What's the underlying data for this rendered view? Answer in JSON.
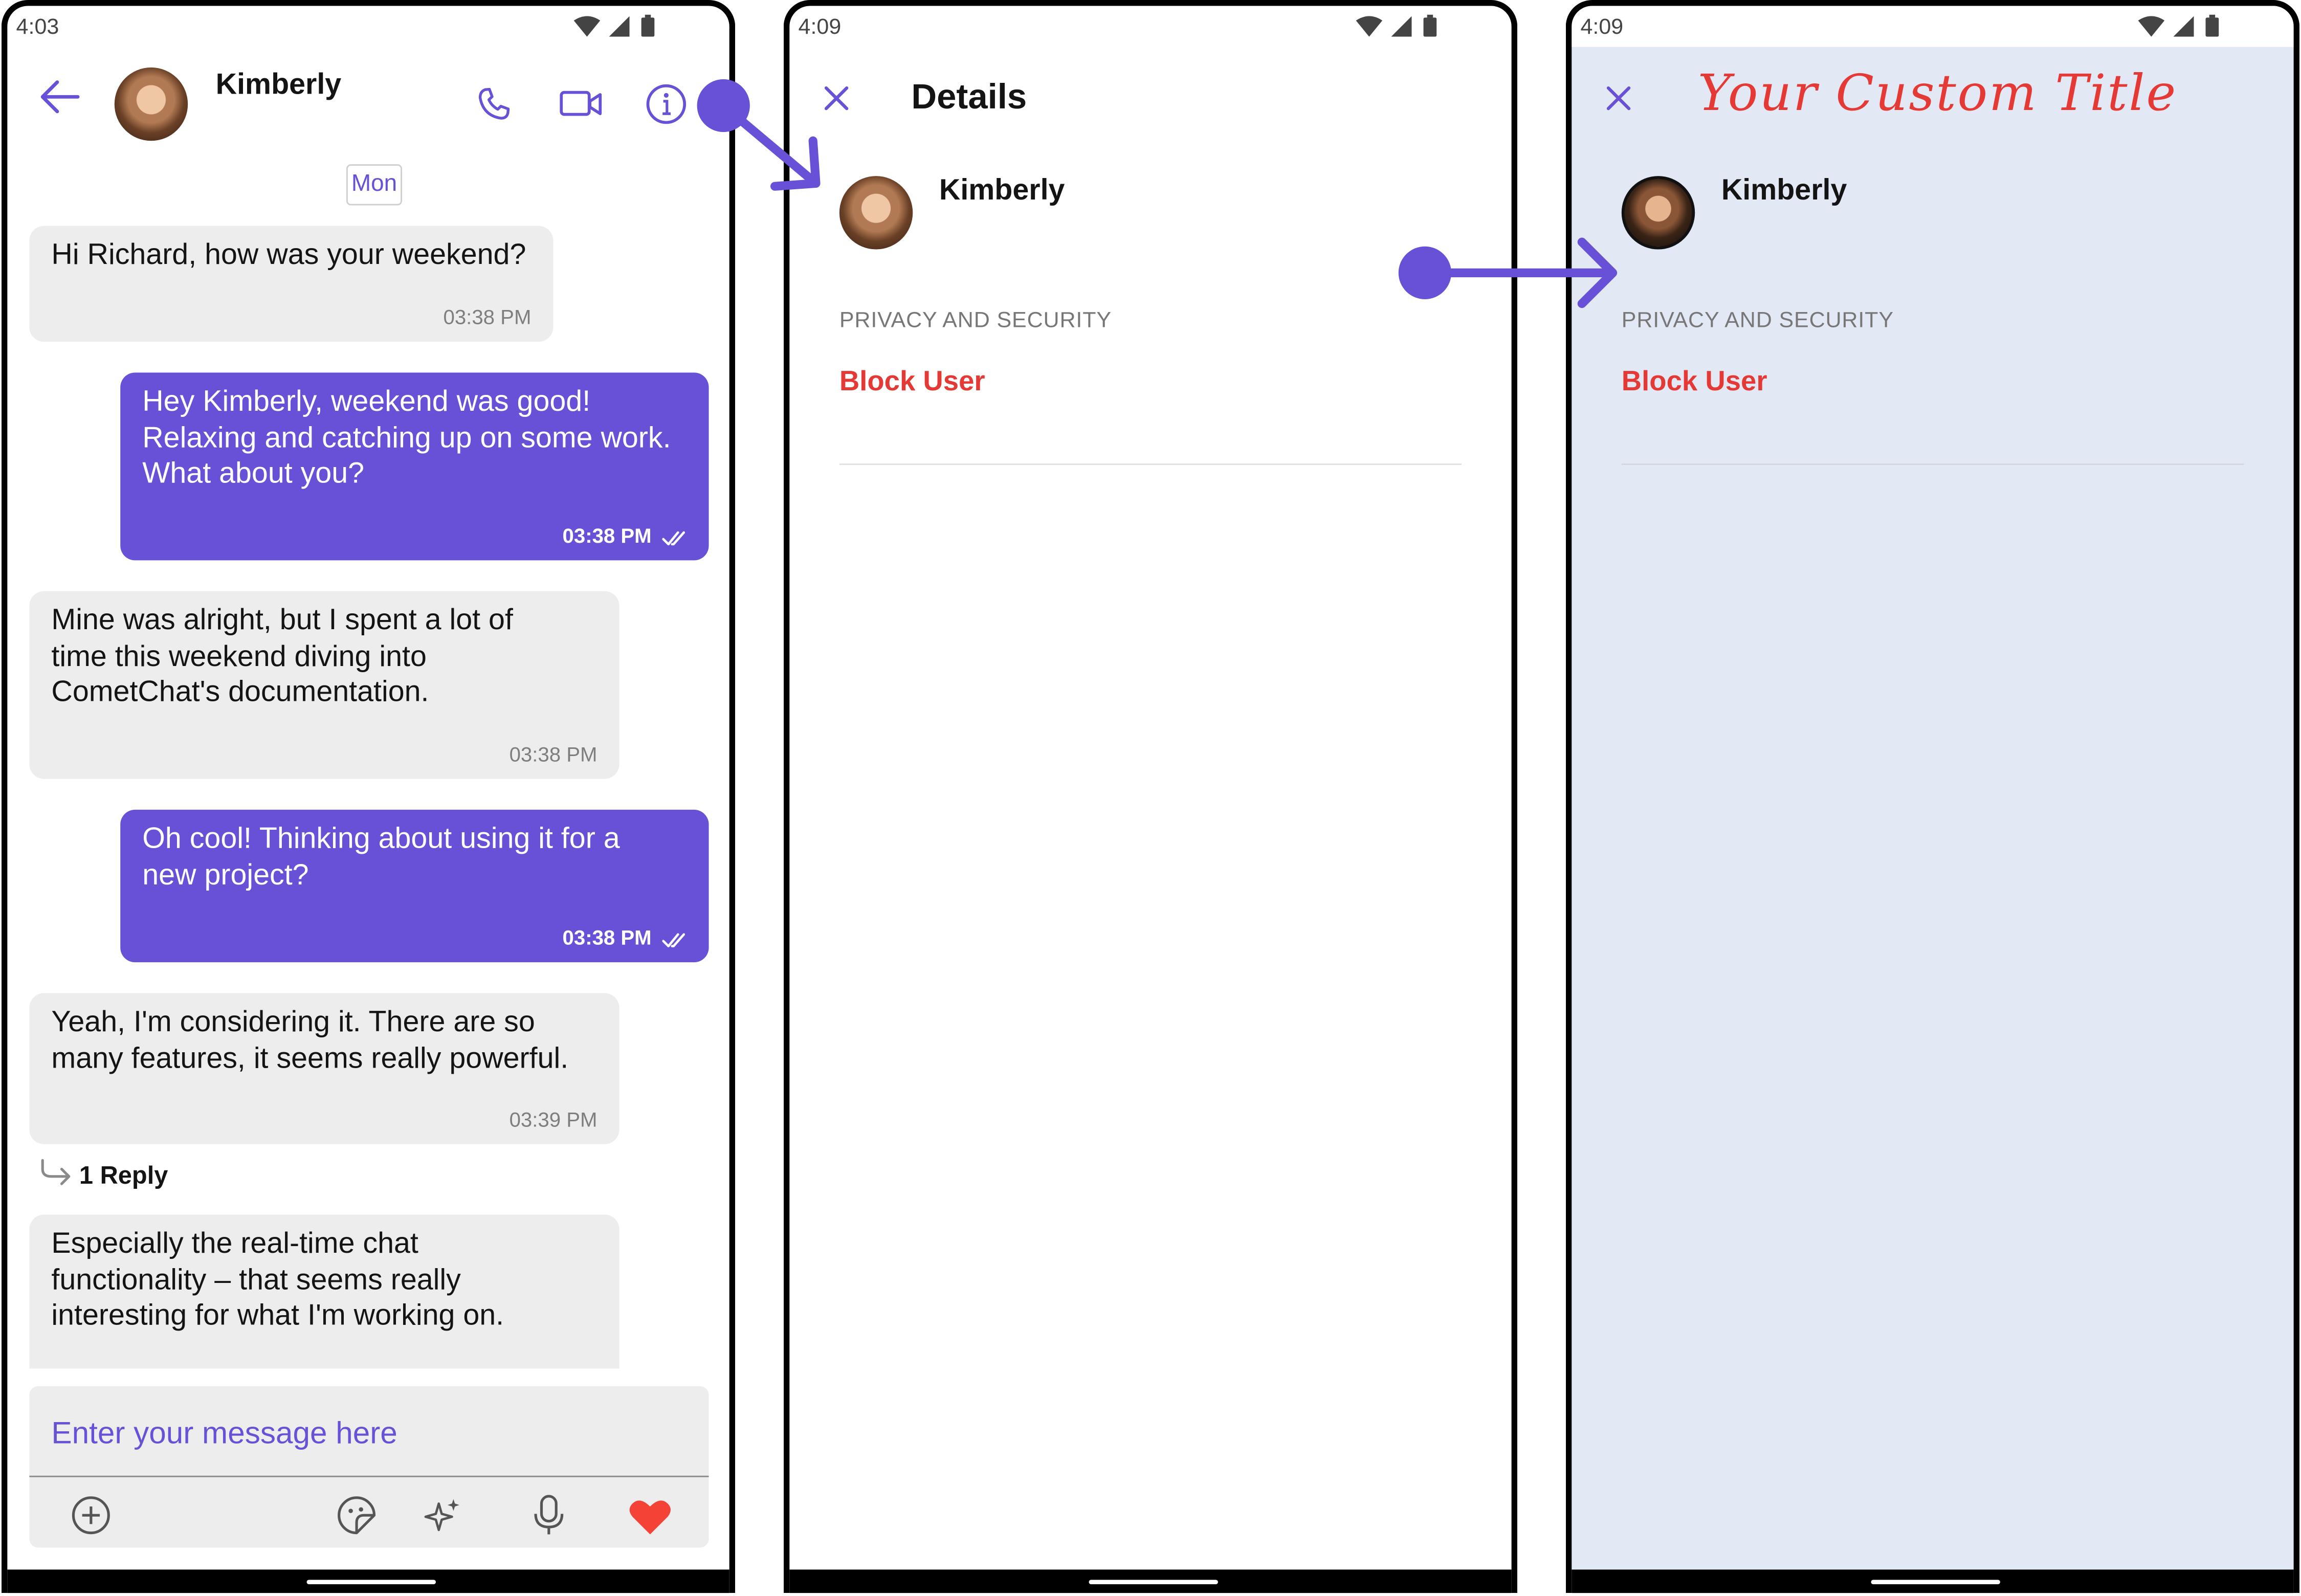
{
  "colors": {
    "accent": "#6851d6",
    "danger": "#e53935",
    "custom_bg": "#e3e9f4"
  },
  "screens": {
    "chat": {
      "status_time": "4:03",
      "header": {
        "name": "Kimberly",
        "icons": [
          "back-arrow-icon",
          "phone-icon",
          "video-icon",
          "info-icon"
        ]
      },
      "date_label": "Mon",
      "messages": [
        {
          "dir": "in",
          "text": "Hi Richard, how was your weekend?",
          "time": "03:38 PM"
        },
        {
          "dir": "out",
          "text": "Hey Kimberly, weekend was good!\nRelaxing and catching up on some work.\nWhat about you?",
          "time": "03:38 PM",
          "read": true
        },
        {
          "dir": "in",
          "text": "Mine was alright, but I spent a lot of\ntime this weekend diving into\nCometChat's documentation.",
          "time": "03:38 PM"
        },
        {
          "dir": "out",
          "text": "Oh cool! Thinking about using it for a\nnew project?",
          "time": "03:38 PM",
          "read": true
        },
        {
          "dir": "in",
          "text": "Yeah, I'm considering it.  There are so\nmany features, it seems really powerful.",
          "time": "03:39 PM"
        },
        {
          "dir": "in",
          "text": "Especially the real-time chat\nfunctionality – that seems really\ninteresting for what I'm working on.",
          "time": ""
        }
      ],
      "reply_label": "1 Reply",
      "composer": {
        "placeholder": "Enter your message here",
        "icons": [
          "add-attachment-icon",
          "sticker-icon",
          "ai-sparkle-icon",
          "microphone-icon",
          "heart-icon"
        ]
      }
    },
    "details": {
      "status_time": "4:09",
      "title": "Details",
      "user_name": "Kimberly",
      "section_label": "PRIVACY AND SECURITY",
      "action_label": "Block User"
    },
    "custom": {
      "status_time": "4:09",
      "title": "Your Custom Title",
      "user_name": "Kimberly",
      "section_label": "PRIVACY AND SECURITY",
      "action_label": "Block User"
    }
  }
}
